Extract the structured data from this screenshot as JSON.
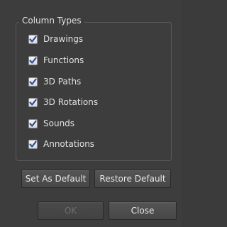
{
  "group": {
    "title": "Column Types",
    "items": [
      {
        "label": "Drawings",
        "checked": true
      },
      {
        "label": "Functions",
        "checked": true
      },
      {
        "label": "3D Paths",
        "checked": true
      },
      {
        "label": "3D Rotations",
        "checked": true
      },
      {
        "label": "Sounds",
        "checked": true
      },
      {
        "label": "Annotations",
        "checked": true
      }
    ]
  },
  "buttons": {
    "set_default": "Set As Default",
    "restore_default": "Restore Default",
    "ok": "OK",
    "close": "Close"
  },
  "icons": {
    "checkmark": "checkmark-icon"
  },
  "colors": {
    "check_accent": "#2f4f9a"
  }
}
